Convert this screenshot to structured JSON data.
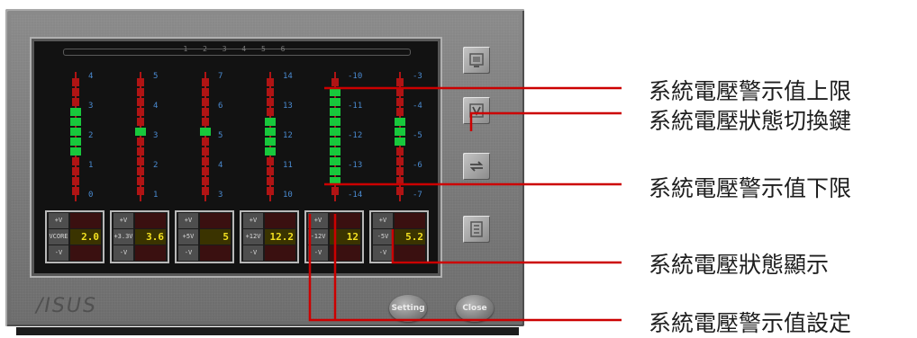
{
  "monitor": {
    "header_text": "1 2 3 4 5 6",
    "brand": "/ISUS",
    "setting_label": "Setting",
    "close_label": "Close",
    "colors": {
      "alarm": "#b01414",
      "ok": "#18c83c",
      "scale": "#4a8ad0",
      "value": "#f2e020"
    },
    "side_buttons": [
      "display-icon",
      "voltage-icon",
      "toggle-icon",
      "list-icon"
    ],
    "channels": [
      {
        "ticks": [
          "4",
          "3",
          "2",
          "1",
          "0"
        ],
        "upper_label": "+V",
        "name": "VCORE",
        "lower_label": "-V",
        "value": "2.0",
        "level_high": 0.75,
        "level_low": 0.35
      },
      {
        "ticks": [
          "5",
          "4",
          "3",
          "2",
          "1"
        ],
        "upper_label": "+V",
        "name": "+3.3V",
        "lower_label": "-V",
        "value": "3.6",
        "level_high": 0.6,
        "level_low": 0.48
      },
      {
        "ticks": [
          "7",
          "6",
          "5",
          "4",
          "3"
        ],
        "upper_label": "+V",
        "name": "+5V",
        "lower_label": "-V",
        "value": "5",
        "level_high": 0.58,
        "level_low": 0.46
      },
      {
        "ticks": [
          "14",
          "13",
          "12",
          "11",
          "10"
        ],
        "upper_label": "+V",
        "name": "+12V",
        "lower_label": "-V",
        "value": "12.2",
        "level_high": 0.7,
        "level_low": 0.35
      },
      {
        "ticks": [
          "-10",
          "-11",
          "-12",
          "-13",
          "-14"
        ],
        "upper_label": "+V",
        "name": "-12V",
        "lower_label": "-V",
        "value": "12",
        "level_high": 0.95,
        "level_low": 0.1
      },
      {
        "ticks": [
          "-3",
          "-4",
          "-5",
          "-6",
          "-7"
        ],
        "upper_label": "+V",
        "name": "-5V",
        "lower_label": "-V",
        "value": "5.2",
        "level_high": 0.7,
        "level_low": 0.4
      }
    ]
  },
  "callouts": [
    "系統電壓警示值上限",
    "系統電壓狀態切換鍵",
    "系統電壓警示值下限",
    "系統電壓狀態顯示",
    "系統電壓警示值設定"
  ]
}
